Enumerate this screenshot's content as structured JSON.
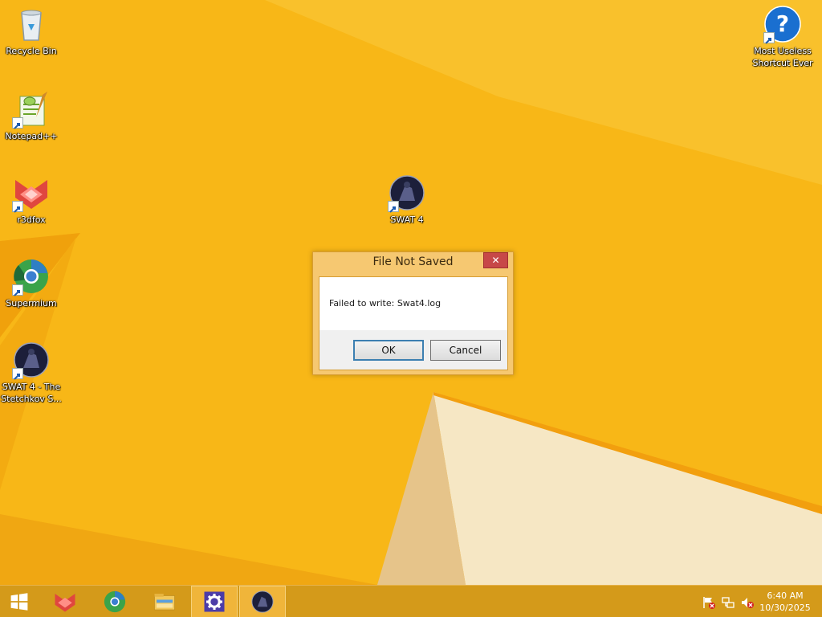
{
  "desktop": {
    "icons": [
      {
        "label": "Recycle Bin"
      },
      {
        "label": "Notepad++"
      },
      {
        "label": "r3dfox"
      },
      {
        "label": "Supermium"
      },
      {
        "label": "SWAT 4 - The Stetchkov S..."
      },
      {
        "label": "SWAT 4"
      },
      {
        "label": "Most Useless Shortcut Ever"
      }
    ]
  },
  "dialog": {
    "title": "File Not Saved",
    "message": "Failed to write: Swat4.log",
    "ok_label": "OK",
    "cancel_label": "Cancel",
    "close_glyph": "✕"
  },
  "taskbar": {
    "items": [
      {
        "icon": "windows-start-icon"
      },
      {
        "icon": "r3dfox-icon"
      },
      {
        "icon": "supermium-icon"
      },
      {
        "icon": "file-explorer-icon"
      },
      {
        "icon": "settings-gear-icon"
      },
      {
        "icon": "swat4-icon"
      }
    ],
    "clock": {
      "time": "6:40 AM",
      "date": "10/30/2025"
    }
  },
  "colors": {
    "wallpaper": "#f7b514",
    "taskbar": "#d49a1a",
    "dialog_frame": "#f6c871",
    "close_button": "#c74848"
  }
}
